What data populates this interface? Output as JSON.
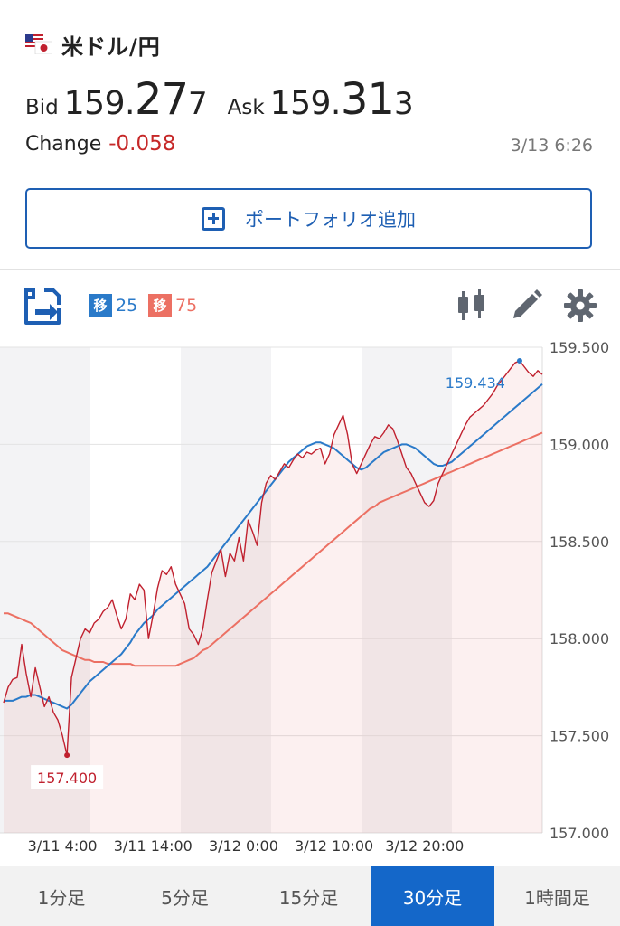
{
  "header": {
    "pair": "米ドル/円",
    "bid_label": "Bid",
    "bid_main": "159.",
    "bid_big": "27",
    "bid_last": "7",
    "ask_label": "Ask",
    "ask_main": "159.",
    "ask_big": "31",
    "ask_last": "3",
    "change_label": "Change",
    "change_value": "-0.058",
    "timestamp": "3/13 6:26"
  },
  "portfolio_button": {
    "label": "ポートフォリオ追加"
  },
  "toolbar": {
    "ma_short": {
      "tag": "移",
      "period": "25"
    },
    "ma_long": {
      "tag": "移",
      "period": "75"
    },
    "icons": [
      "chart-export-icon",
      "candlestick-icon",
      "pencil-icon",
      "gear-icon"
    ]
  },
  "colors": {
    "price": "#c0202e",
    "ma_short": "#2a7ac9",
    "ma_long": "#ec7063",
    "accent": "#1467c9"
  },
  "chart_data": {
    "type": "line",
    "ylim": [
      157.0,
      159.5
    ],
    "y_ticks": [
      "157.000",
      "157.500",
      "158.000",
      "158.500",
      "159.000",
      "159.500"
    ],
    "x_tick_labels": [
      "3/11 4:00",
      "3/11 14:00",
      "3/12 0:00",
      "3/12 10:00",
      "3/12 20:00"
    ],
    "x_tick_index": [
      13,
      33,
      53,
      73,
      93
    ],
    "n_points": 120,
    "high_label": "159.434",
    "low_label": "157.400",
    "series": [
      {
        "values": [
          157.67,
          157.75,
          157.79,
          157.8,
          157.97,
          157.82,
          157.7,
          157.85,
          157.75,
          157.65,
          157.7,
          157.62,
          157.58,
          157.5,
          157.4,
          157.8,
          157.9,
          158.0,
          158.05,
          158.03,
          158.08,
          158.1,
          158.14,
          158.16,
          158.2,
          158.12,
          158.05,
          158.1,
          158.23,
          158.2,
          158.28,
          158.25,
          158.0,
          158.12,
          158.26,
          158.35,
          158.33,
          158.37,
          158.28,
          158.23,
          158.18,
          158.05,
          158.02,
          157.97,
          158.05,
          158.2,
          158.34,
          158.4,
          158.46,
          158.32,
          158.44,
          158.4,
          158.52,
          158.4,
          158.61,
          158.55,
          158.48,
          158.7,
          158.8,
          158.84,
          158.82,
          158.86,
          158.9,
          158.88,
          158.92,
          158.95,
          158.93,
          158.96,
          158.95,
          158.97,
          158.98,
          158.9,
          158.95,
          159.05,
          159.1,
          159.15,
          159.05,
          158.9,
          158.85,
          158.9,
          158.95,
          159.0,
          159.04,
          159.03,
          159.06,
          159.1,
          159.08,
          159.02,
          158.95,
          158.88,
          158.85,
          158.8,
          158.75,
          158.7,
          158.68,
          158.71,
          158.8,
          158.85,
          158.9,
          158.95,
          159.0,
          159.05,
          159.1,
          159.14,
          159.16,
          159.18,
          159.2,
          159.23,
          159.26,
          159.3,
          159.33,
          159.36,
          159.39,
          159.42,
          159.43,
          159.4,
          159.37,
          159.35,
          159.38,
          159.36
        ]
      },
      {
        "values": [
          157.68,
          157.68,
          157.68,
          157.69,
          157.7,
          157.7,
          157.71,
          157.71,
          157.7,
          157.69,
          157.68,
          157.67,
          157.66,
          157.65,
          157.64,
          157.66,
          157.69,
          157.72,
          157.75,
          157.78,
          157.8,
          157.82,
          157.84,
          157.86,
          157.88,
          157.9,
          157.92,
          157.95,
          157.98,
          158.02,
          158.05,
          158.08,
          158.1,
          158.12,
          158.15,
          158.17,
          158.19,
          158.21,
          158.23,
          158.25,
          158.27,
          158.29,
          158.31,
          158.33,
          158.35,
          158.37,
          158.4,
          158.43,
          158.46,
          158.49,
          158.52,
          158.55,
          158.58,
          158.61,
          158.64,
          158.67,
          158.7,
          158.73,
          158.76,
          158.79,
          158.82,
          158.85,
          158.88,
          158.91,
          158.93,
          158.95,
          158.97,
          158.99,
          159.0,
          159.01,
          159.01,
          159.0,
          158.99,
          158.98,
          158.96,
          158.94,
          158.92,
          158.9,
          158.88,
          158.87,
          158.88,
          158.9,
          158.92,
          158.94,
          158.96,
          158.97,
          158.98,
          158.99,
          159.0,
          159.0,
          158.99,
          158.98,
          158.96,
          158.94,
          158.92,
          158.9,
          158.89,
          158.89,
          158.9,
          158.91,
          158.93,
          158.95,
          158.97,
          158.99,
          159.01,
          159.03,
          159.05,
          159.07,
          159.09,
          159.11,
          159.13,
          159.15,
          159.17,
          159.19,
          159.21,
          159.23,
          159.25,
          159.27,
          159.29,
          159.31
        ]
      },
      {
        "values": [
          158.13,
          158.13,
          158.12,
          158.11,
          158.1,
          158.09,
          158.08,
          158.06,
          158.04,
          158.02,
          158.0,
          157.98,
          157.96,
          157.94,
          157.93,
          157.92,
          157.91,
          157.9,
          157.89,
          157.89,
          157.88,
          157.88,
          157.88,
          157.87,
          157.87,
          157.87,
          157.87,
          157.87,
          157.87,
          157.86,
          157.86,
          157.86,
          157.86,
          157.86,
          157.86,
          157.86,
          157.86,
          157.86,
          157.86,
          157.87,
          157.88,
          157.89,
          157.9,
          157.92,
          157.94,
          157.95,
          157.97,
          157.99,
          158.01,
          158.03,
          158.05,
          158.07,
          158.09,
          158.11,
          158.13,
          158.15,
          158.17,
          158.19,
          158.21,
          158.23,
          158.25,
          158.27,
          158.29,
          158.31,
          158.33,
          158.35,
          158.37,
          158.39,
          158.41,
          158.43,
          158.45,
          158.47,
          158.49,
          158.51,
          158.53,
          158.55,
          158.57,
          158.59,
          158.61,
          158.63,
          158.65,
          158.67,
          158.68,
          158.7,
          158.71,
          158.72,
          158.73,
          158.74,
          158.75,
          158.76,
          158.77,
          158.78,
          158.79,
          158.8,
          158.81,
          158.82,
          158.83,
          158.84,
          158.85,
          158.86,
          158.87,
          158.88,
          158.89,
          158.9,
          158.91,
          158.92,
          158.93,
          158.94,
          158.95,
          158.96,
          158.97,
          158.98,
          158.99,
          159.0,
          159.01,
          159.02,
          159.03,
          159.04,
          159.05,
          159.06
        ]
      }
    ]
  },
  "timeframes": [
    {
      "label": "1分足"
    },
    {
      "label": "5分足"
    },
    {
      "label": "15分足"
    },
    {
      "label": "30分足",
      "active": true
    },
    {
      "label": "1時間足"
    }
  ]
}
